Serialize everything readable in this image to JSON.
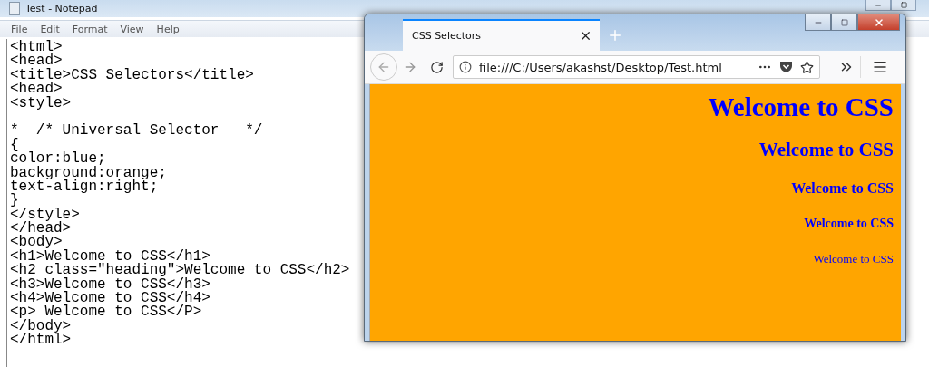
{
  "notepad": {
    "title": "Test - Notepad",
    "menu": [
      "File",
      "Edit",
      "Format",
      "View",
      "Help"
    ],
    "blocks": [
      [
        "<html>",
        "<head>",
        "<title>CSS Selectors</title>",
        "<head>",
        "<style>"
      ],
      [
        "*  /* Universal Selector   */",
        "{",
        "color:blue;",
        "background:orange;",
        "text-align:right;",
        "}",
        "</style>",
        "</head>",
        "<body>",
        "<h1>Welcome to CSS</h1>",
        "<h2 class=\"heading\">Welcome to CSS</h2>",
        "<h3>Welcome to CSS</h3>",
        "<h4>Welcome to CSS</h4>",
        "<p> Welcome to CSS</P>",
        "</body>",
        "</html>"
      ]
    ]
  },
  "browser": {
    "tabs": [
      {
        "label": "CSS Selectors",
        "selected": true
      }
    ],
    "address": "file:///C:/Users/akashst/Desktop/Test.html",
    "content": [
      {
        "kind": "h1",
        "text": "Welcome to CSS"
      },
      {
        "kind": "h2",
        "text": "Welcome to CSS"
      },
      {
        "kind": "h3",
        "text": "Welcome to CSS"
      },
      {
        "kind": "h4",
        "text": "Welcome to CSS"
      },
      {
        "kind": "p",
        "text": "Welcome to CSS"
      }
    ]
  }
}
